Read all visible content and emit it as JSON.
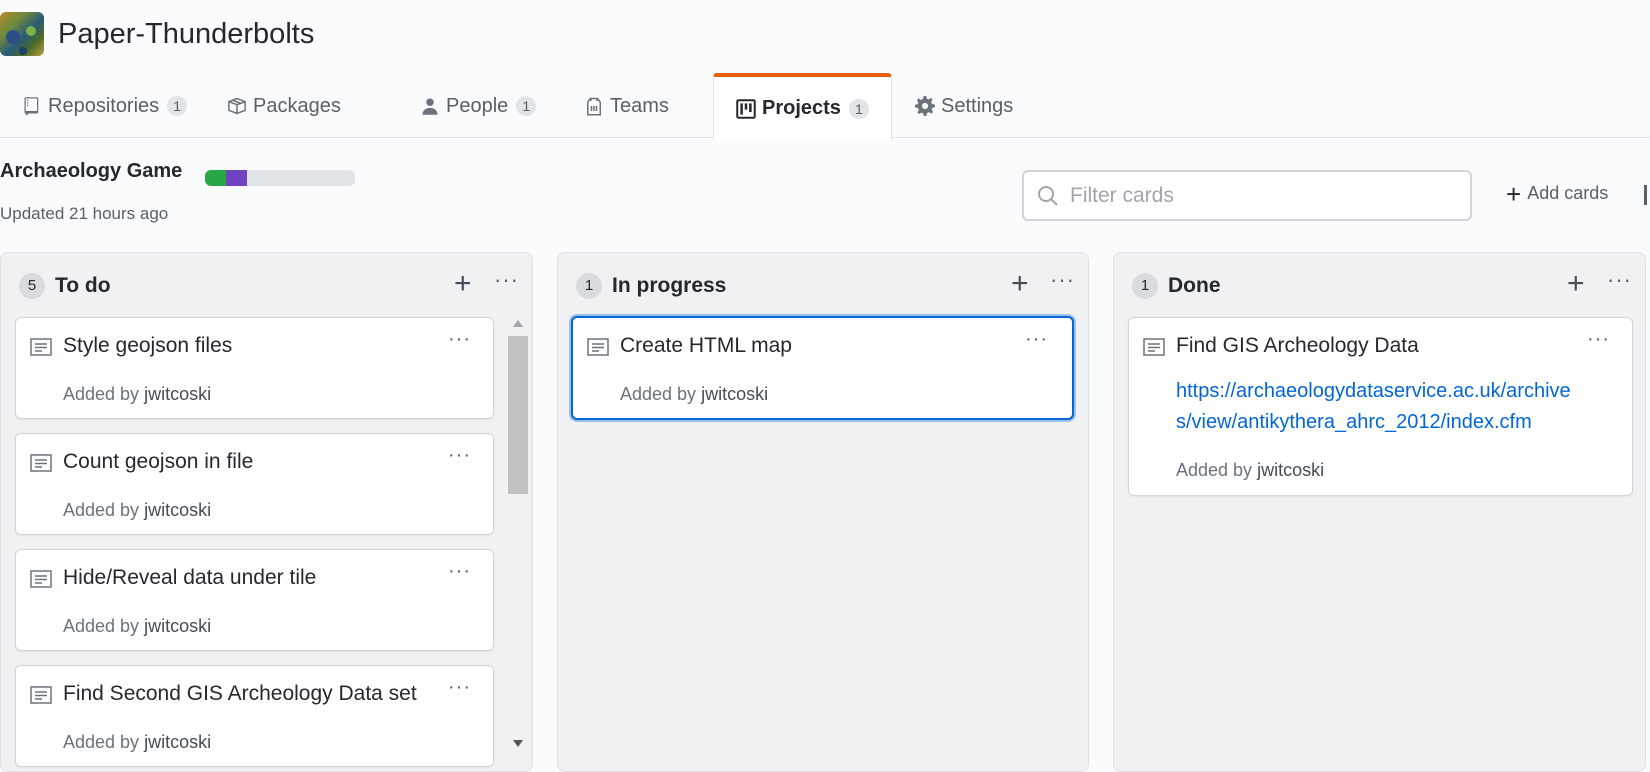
{
  "org": {
    "name": "Paper-Thunderbolts"
  },
  "tabs": [
    {
      "label": "Repositories",
      "count": "1",
      "icon": "repo-icon"
    },
    {
      "label": "Packages",
      "count": "",
      "icon": "package-icon"
    },
    {
      "label": "People",
      "count": "1",
      "icon": "person-icon"
    },
    {
      "label": "Teams",
      "count": "",
      "icon": "team-icon"
    },
    {
      "label": "Projects",
      "count": "1",
      "icon": "project-icon",
      "selected": true
    },
    {
      "label": "Settings",
      "count": "",
      "icon": "gear-icon"
    }
  ],
  "project": {
    "title": "Archaeology Game",
    "updated": "Updated 21 hours ago",
    "progress": {
      "done_fraction": 0.14,
      "in_progress_fraction": 0.14,
      "done_color": "#28a745",
      "in_progress_color": "#6f42c1"
    }
  },
  "filter": {
    "placeholder": "Filter cards",
    "value": ""
  },
  "add_cards_label": "Add cards",
  "columns": [
    {
      "name": "To do",
      "count": "5",
      "cards": [
        {
          "title": "Style geojson files",
          "added_by_prefix": "Added by",
          "user": "jwitcoski"
        },
        {
          "title": "Count geojson in file",
          "added_by_prefix": "Added by",
          "user": "jwitcoski"
        },
        {
          "title": "Hide/Reveal data under tile",
          "added_by_prefix": "Added by",
          "user": "jwitcoski"
        },
        {
          "title": "Find Second GIS Archeology Data set",
          "added_by_prefix": "Added by",
          "user": "jwitcoski"
        }
      ]
    },
    {
      "name": "In progress",
      "count": "1",
      "cards": [
        {
          "title": "Create HTML map",
          "added_by_prefix": "Added by",
          "user": "jwitcoski"
        }
      ]
    },
    {
      "name": "Done",
      "count": "1",
      "cards": [
        {
          "title": "Find GIS Archeology Data",
          "link": "https://archaeologydataservice.ac.uk/archives/view/antikythera_ahrc_2012/index.cfm",
          "added_by_prefix": "Added by",
          "user": "jwitcoski"
        }
      ]
    }
  ],
  "colors": {
    "accent_tab": "#e36209",
    "link": "#0366d6",
    "focus": "#0366d6"
  }
}
